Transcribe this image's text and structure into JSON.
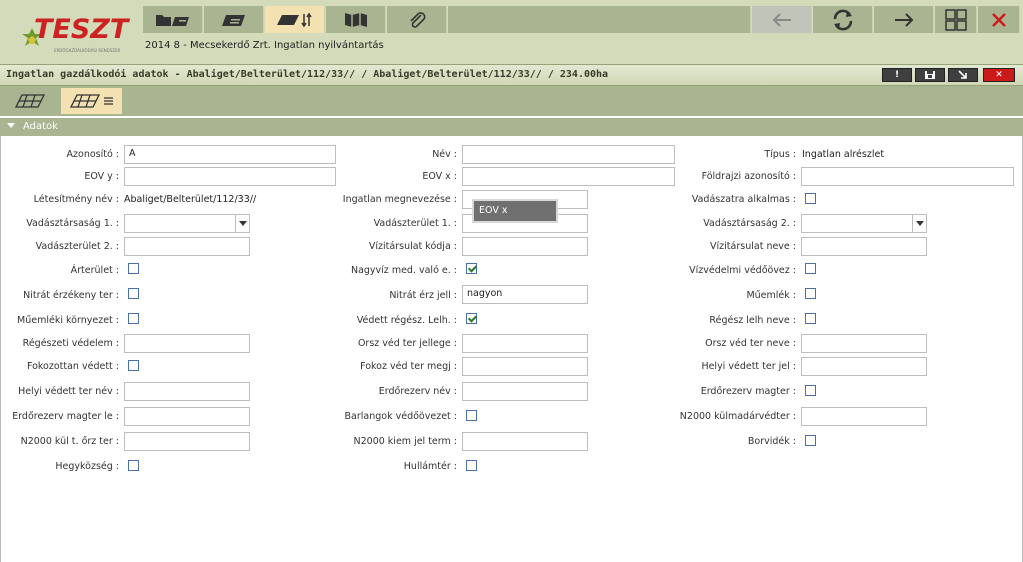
{
  "app": {
    "logo_text": "TESZT",
    "logo_sub": "ERDŐGAZDÁLKODÁSI RENDSZER",
    "subtitle": "2014 8 - Mecsekerdő Zrt. Ingatlan nyilvántartás",
    "toolbar_icons": [
      "folder-map-icon",
      "parcel-icon",
      "parcel-sort-icon",
      "forest-map-icon",
      "paperclip-icon",
      "back-arrow-icon",
      "refresh-icon",
      "forward-arrow-icon",
      "grid-icon",
      "close-icon"
    ]
  },
  "window": {
    "title": "Ingatlan gazdálkodói adatok - Abaliget/Belterület/112/33// / Abaliget/Belterület/112/33// / 234.00ha",
    "buttons": [
      "!",
      "save-icon",
      "minimize-icon",
      "✕"
    ]
  },
  "section": {
    "label": "Adatok"
  },
  "fields": {
    "azonosito": {
      "label": "Azonosító :",
      "value": "A"
    },
    "nev": {
      "label": "Név :",
      "value": ""
    },
    "tipus": {
      "label": "Típus :",
      "value": "Ingatlan alrészlet"
    },
    "eov_y": {
      "label": "EOV y :",
      "value": ""
    },
    "eov_x": {
      "label": "EOV x :",
      "value": ""
    },
    "foldrajzi_azonosito": {
      "label": "Földrajzi azonosító :",
      "value": ""
    },
    "letesitmeny_nev": {
      "label": "Létesítmény név :",
      "value": "Abaliget/Belterület/112/33//"
    },
    "ingatlan_megnevezese": {
      "label": "Ingatlan megnevezése :",
      "value": ""
    },
    "vadaszatra_alkalmas": {
      "label": "Vadászatra alkalmas :",
      "checked": false
    },
    "vadasztarsasag_1": {
      "label": "Vadásztársaság 1. :",
      "value": ""
    },
    "vadaszterulet_1": {
      "label": "Vadászterület 1. :",
      "value": ""
    },
    "vadasztarsasag_2": {
      "label": "Vadásztársaság 2. :",
      "value": ""
    },
    "vadaszterulet_2": {
      "label": "Vadászterület 2. :",
      "value": ""
    },
    "vizitarsulat_kodja": {
      "label": "Vízitársulat kódja :",
      "value": ""
    },
    "vizitarsulat_neve": {
      "label": "Vízitársulat neve :",
      "value": ""
    },
    "arterulet": {
      "label": "Árterület :",
      "checked": false
    },
    "nagyviz_med": {
      "label": "Nagyvíz med. való e. :",
      "checked": true
    },
    "vizvedelmi_vedoovez": {
      "label": "Vízvédelmi védőövez :",
      "checked": false
    },
    "nitrat_erzekeny_ter": {
      "label": "Nitrát érzékeny ter :",
      "checked": false
    },
    "nitrat_erz_jell": {
      "label": "Nitrát érz jell :",
      "value": "nagyon"
    },
    "muemlek": {
      "label": "Műemlék :",
      "checked": false
    },
    "muemleki_kornyezet": {
      "label": "Műemléki környezet :",
      "checked": false
    },
    "vedett_regesz_lelh": {
      "label": "Védett régész. Lelh. :",
      "checked": true
    },
    "regesz_lelh_neve": {
      "label": "Régész lelh neve :",
      "checked": false
    },
    "regeszeti_vedelem": {
      "label": "Régészeti védelem :",
      "value": ""
    },
    "orsz_ved_ter_jellege": {
      "label": "Orsz véd ter jellege :",
      "value": ""
    },
    "orsz_ved_ter_neve": {
      "label": "Orsz véd ter neve :",
      "value": ""
    },
    "fokozottan_vedett": {
      "label": "Fokozottan védett :",
      "checked": false
    },
    "fokoz_ved_ter_megj": {
      "label": "Fokoz véd ter megj :",
      "value": ""
    },
    "helyi_vedett_ter_jel": {
      "label": "Helyi védett ter jel :",
      "value": ""
    },
    "helyi_vedett_ter_nev": {
      "label": "Helyi védett ter név :",
      "value": ""
    },
    "erdorezerv_nev": {
      "label": "Erdőrezerv név :",
      "value": ""
    },
    "erdorezerv_magter": {
      "label": "Erdőrezerv magter :",
      "checked": false
    },
    "erdorezerv_magter_le": {
      "label": "Erdőrezerv magter le :",
      "value": ""
    },
    "barlangok_vedoovezet": {
      "label": "Barlangok védőövezet :",
      "checked": false
    },
    "n2000_kulmadarvedter": {
      "label": "N2000 külmadárvédter :",
      "value": ""
    },
    "n2000_kul_t_orz_ter": {
      "label": "N2000 kül t. őrz ter :",
      "value": ""
    },
    "n2000_kiem_jel_term": {
      "label": "N2000 kiem jel term :",
      "value": ""
    },
    "borvidek": {
      "label": "Borvidék :",
      "checked": false
    },
    "hegykozseg": {
      "label": "Hegyközség :",
      "checked": false
    },
    "hullamter": {
      "label": "Hullámtér :",
      "checked": false
    }
  },
  "tooltip": {
    "text": "EOV x"
  },
  "colors": {
    "toolbar_bg": "#a9b490",
    "topbar_bg": "#d3dbbb",
    "active_tab": "#f3e1b2",
    "close_red": "#cc1a1a"
  }
}
